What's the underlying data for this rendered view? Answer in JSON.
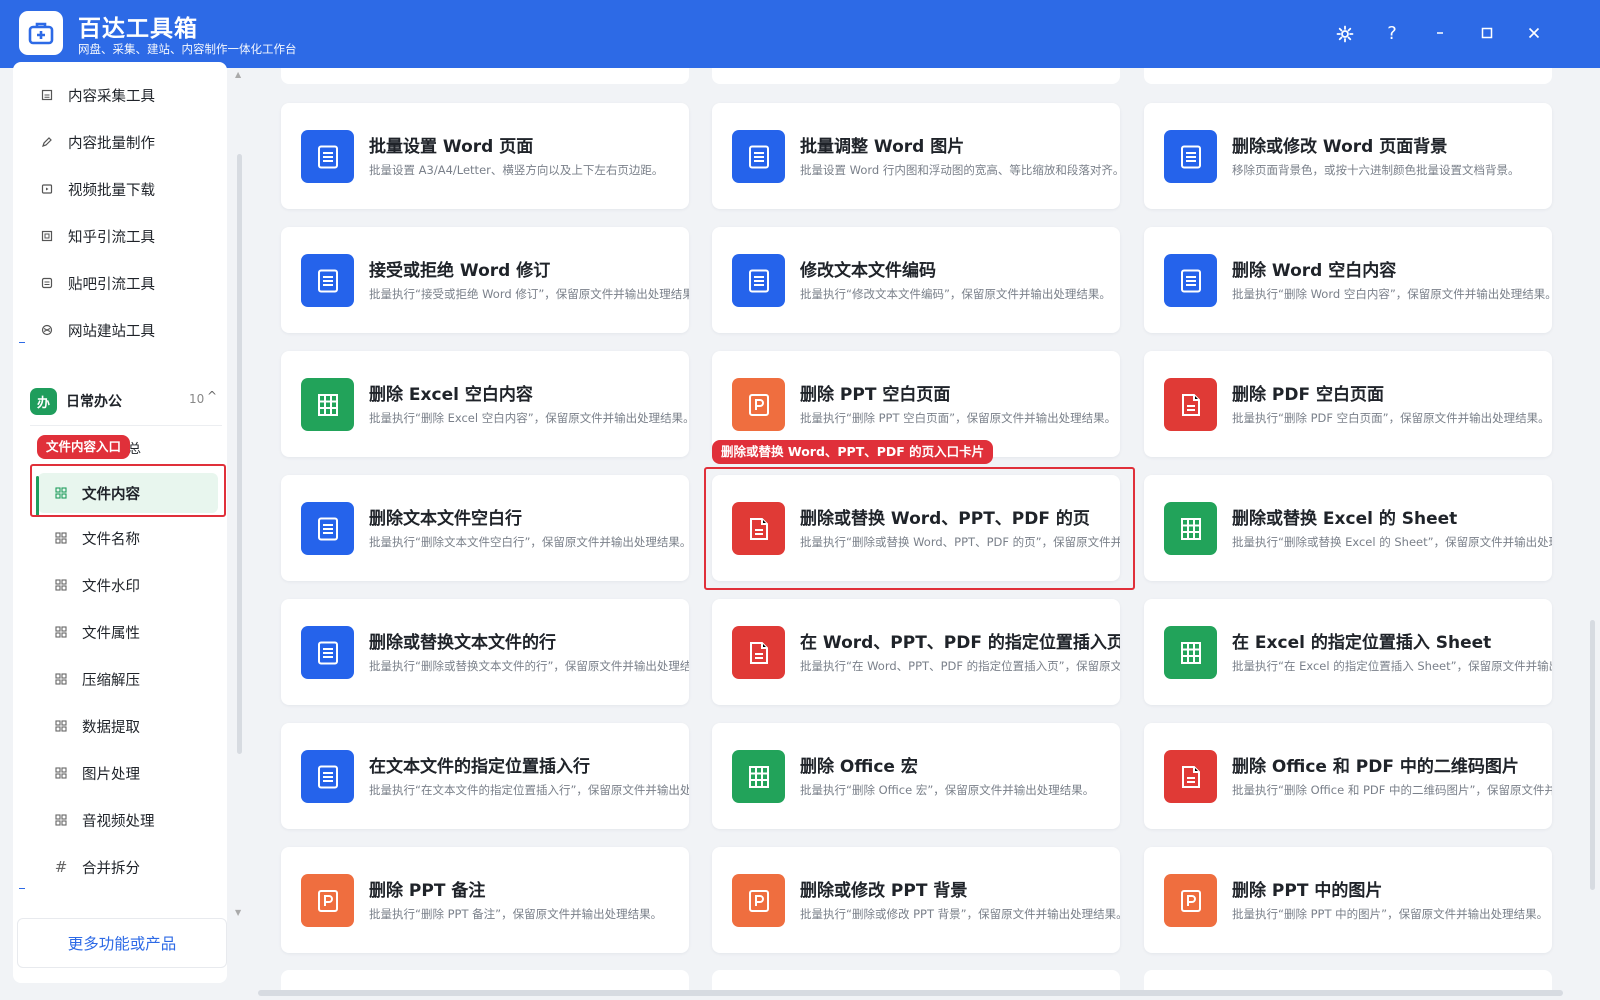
{
  "app": {
    "title": "百达工具箱",
    "subtitle": "网盘、采集、建站、内容制作一体化工作台"
  },
  "window_controls": [
    "settings",
    "help",
    "minimize",
    "maximize",
    "close"
  ],
  "sidebar": {
    "top_items": [
      {
        "label": "内容采集工具",
        "icon": "collect-icon"
      },
      {
        "label": "内容批量制作",
        "icon": "pen-icon"
      },
      {
        "label": "视频批量下载",
        "icon": "video-icon"
      },
      {
        "label": "知乎引流工具",
        "icon": "zhihu-icon"
      },
      {
        "label": "贴吧引流工具",
        "icon": "tieba-icon"
      },
      {
        "label": "网站建站工具",
        "icon": "globe-icon"
      }
    ],
    "group": {
      "badge": "办",
      "title": "日常办公",
      "count": "10",
      "caret": "^"
    },
    "hidden_item_fragment": "总",
    "items": [
      {
        "label": "文件内容",
        "icon": "grid-icon",
        "active": true
      },
      {
        "label": "文件名称",
        "icon": "grid-icon"
      },
      {
        "label": "文件水印",
        "icon": "grid-icon"
      },
      {
        "label": "文件属性",
        "icon": "grid-icon"
      },
      {
        "label": "压缩解压",
        "icon": "grid-icon"
      },
      {
        "label": "数据提取",
        "icon": "grid-icon"
      },
      {
        "label": "图片处理",
        "icon": "grid-icon"
      },
      {
        "label": "音视频处理",
        "icon": "grid-icon"
      },
      {
        "label": "合并拆分",
        "icon": "hash-icon"
      }
    ],
    "more_label": "更多功能或产品"
  },
  "annotations": {
    "sidebar_tag": "文件内容入口",
    "card_tag": "删除或替换 Word、PPT、PDF 的页入口卡片"
  },
  "colors": {
    "titlebar": "#2d6ae6",
    "word": "#2563eb",
    "excel": "#22a35a",
    "ppt": "#ef6e3f",
    "pdf": "#e03a36",
    "annotation": "#e0303a",
    "group_green": "#1f9d5c"
  },
  "cards": [
    [
      {
        "type": "word",
        "title": "批量设置 Word 页面",
        "desc": "批量设置 A3/A4/Letter、横竖方向以及上下左右页边距。"
      },
      {
        "type": "word",
        "title": "批量调整 Word 图片",
        "desc": "批量设置 Word 行内图和浮动图的宽高、等比缩放和段落对齐。"
      },
      {
        "type": "word",
        "title": "删除或修改 Word 页面背景",
        "desc": "移除页面背景色，或按十六进制颜色批量设置文档背景。"
      }
    ],
    [
      {
        "type": "word",
        "title": "接受或拒绝 Word 修订",
        "desc": "批量执行“接受或拒绝 Word 修订”，保留原文件并输出处理结果。"
      },
      {
        "type": "word",
        "title": "修改文本文件编码",
        "desc": "批量执行“修改文本文件编码”，保留原文件并输出处理结果。"
      },
      {
        "type": "word",
        "title": "删除 Word 空白内容",
        "desc": "批量执行“删除 Word 空白内容”，保留原文件并输出处理结果。"
      }
    ],
    [
      {
        "type": "excel",
        "title": "删除 Excel 空白内容",
        "desc": "批量执行“删除 Excel 空白内容”，保留原文件并输出处理结果。"
      },
      {
        "type": "ppt",
        "title": "删除 PPT 空白页面",
        "desc": "批量执行“删除 PPT 空白页面”，保留原文件并输出处理结果。"
      },
      {
        "type": "pdf",
        "title": "删除 PDF 空白页面",
        "desc": "批量执行“删除 PDF 空白页面”，保留原文件并输出处理结果。"
      }
    ],
    [
      {
        "type": "word",
        "title": "删除文本文件空白行",
        "desc": "批量执行“删除文本文件空白行”，保留原文件并输出处理结果。"
      },
      {
        "type": "pdf",
        "title": "删除或替换 Word、PPT、PDF 的页",
        "desc": "批量执行“删除或替换 Word、PPT、PDF 的页”，保留原文件并输出处理结果。"
      },
      {
        "type": "excel",
        "title": "删除或替换 Excel 的 Sheet",
        "desc": "批量执行“删除或替换 Excel 的 Sheet”，保留原文件并输出处理结果。"
      }
    ],
    [
      {
        "type": "word",
        "title": "删除或替换文本文件的行",
        "desc": "批量执行“删除或替换文本文件的行”，保留原文件并输出处理结果。"
      },
      {
        "type": "pdf",
        "title": "在 Word、PPT、PDF 的指定位置插入页",
        "desc": "批量执行“在 Word、PPT、PDF 的指定位置插入页”，保留原文件并输出处理结果。"
      },
      {
        "type": "excel",
        "title": "在 Excel 的指定位置插入 Sheet",
        "desc": "批量执行“在 Excel 的指定位置插入 Sheet”，保留原文件并输出处理结果。"
      }
    ],
    [
      {
        "type": "word",
        "title": "在文本文件的指定位置插入行",
        "desc": "批量执行“在文本文件的指定位置插入行”，保留原文件并输出处理结果。"
      },
      {
        "type": "excel",
        "title": "删除 Office 宏",
        "desc": "批量执行“删除 Office 宏”，保留原文件并输出处理结果。"
      },
      {
        "type": "pdf",
        "title": "删除 Office 和 PDF 中的二维码图片",
        "desc": "批量执行“删除 Office 和 PDF 中的二维码图片”，保留原文件并输出处理结果。"
      }
    ],
    [
      {
        "type": "ppt",
        "title": "删除 PPT 备注",
        "desc": "批量执行“删除 PPT 备注”，保留原文件并输出处理结果。"
      },
      {
        "type": "ppt",
        "title": "删除或修改 PPT 背景",
        "desc": "批量执行“删除或修改 PPT 背景”，保留原文件并输出处理结果。"
      },
      {
        "type": "ppt",
        "title": "删除 PPT 中的图片",
        "desc": "批量执行“删除 PPT 中的图片”，保留原文件并输出处理结果。"
      }
    ]
  ]
}
